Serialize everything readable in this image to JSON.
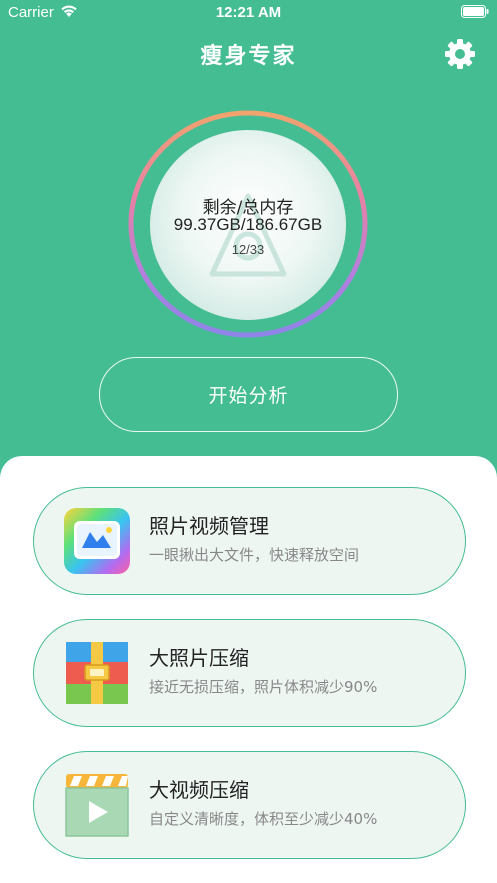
{
  "status_bar": {
    "carrier": "Carrier",
    "time": "12:21 AM"
  },
  "nav": {
    "title": "瘦身专家",
    "settings_icon": "gear-icon"
  },
  "storage": {
    "label": "剩余/总内存",
    "value": "99.37GB/186.67GB",
    "count": "12/33",
    "ring_colors": [
      "#f0a36e",
      "#e77fa9",
      "#b07fe0",
      "#8f84e8"
    ]
  },
  "start_button": {
    "label": "开始分析"
  },
  "features": [
    {
      "title": "照片视频管理",
      "subtitle": "一眼揪出大文件，快速释放空间",
      "icon": "photo-gallery-icon"
    },
    {
      "title": "大照片压缩",
      "subtitle": "接近无损压缩，照片体积减少90%",
      "icon": "archive-box-icon"
    },
    {
      "title": "大视频压缩",
      "subtitle": "自定义清晰度，体积至少减少40%",
      "icon": "video-clapper-icon"
    }
  ],
  "colors": {
    "background": "#45bd93",
    "card_bg": "#eef6f2",
    "card_border": "#45bd93"
  }
}
